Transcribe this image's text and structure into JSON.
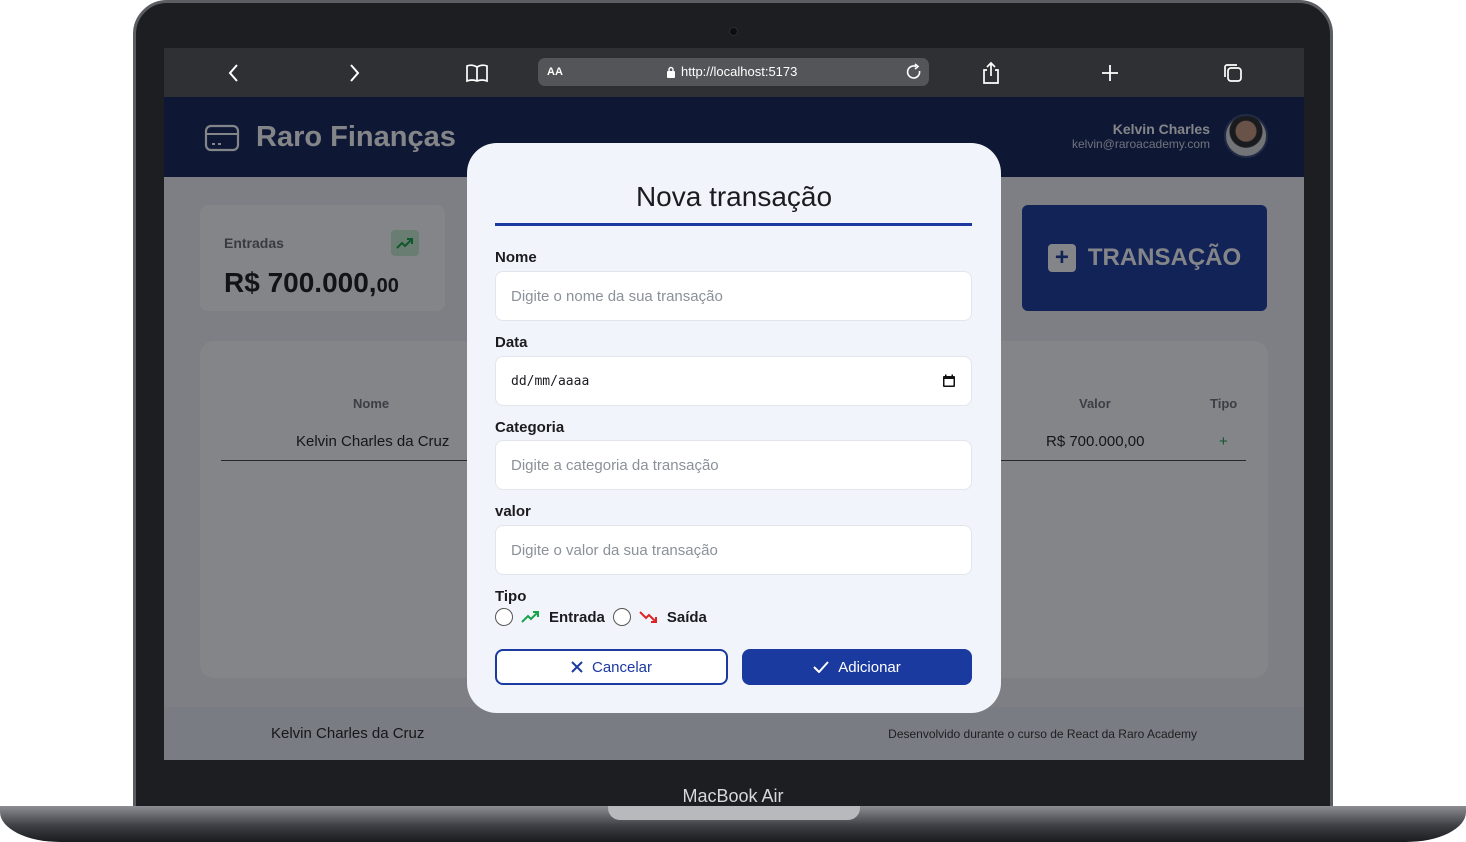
{
  "device": {
    "label": "MacBook Air"
  },
  "browser": {
    "reader_label": "AA",
    "url": "http://localhost:5173"
  },
  "app": {
    "title": "Raro Finanças",
    "user": {
      "name": "Kelvin Charles",
      "email": "kelvin@raroacademy.com"
    }
  },
  "summary_card": {
    "label": "Entradas",
    "value_main": "R$ 700.000,",
    "value_cents": "00"
  },
  "new_button": {
    "label": "TRANSAÇÃO"
  },
  "table": {
    "headers": {
      "name": "Nome",
      "value": "Valor",
      "type": "Tipo"
    },
    "rows": [
      {
        "name": "Kelvin Charles da Cruz",
        "value": "R$ 700.000,00",
        "type": "+"
      }
    ]
  },
  "footer": {
    "left": "Kelvin Charles da Cruz",
    "right": "Desenvolvido durante o curso de React da Raro Academy"
  },
  "modal": {
    "title": "Nova transação",
    "fields": {
      "name": {
        "label": "Nome",
        "placeholder": "Digite o nome da sua transação"
      },
      "date": {
        "label": "Data",
        "placeholder": "dd/mm/aaaa"
      },
      "category": {
        "label": "Categoria",
        "placeholder": "Digite a categoria da transação"
      },
      "value": {
        "label": "valor",
        "placeholder": "Digite o valor da sua transação"
      }
    },
    "type": {
      "label": "Tipo",
      "option_in": "Entrada",
      "option_out": "Saída"
    },
    "cancel_label": "Cancelar",
    "add_label": "Adicionar"
  },
  "colors": {
    "primary": "#1b3a9f",
    "header": "#132559",
    "income": "#16a34a",
    "expense": "#dc2626"
  }
}
